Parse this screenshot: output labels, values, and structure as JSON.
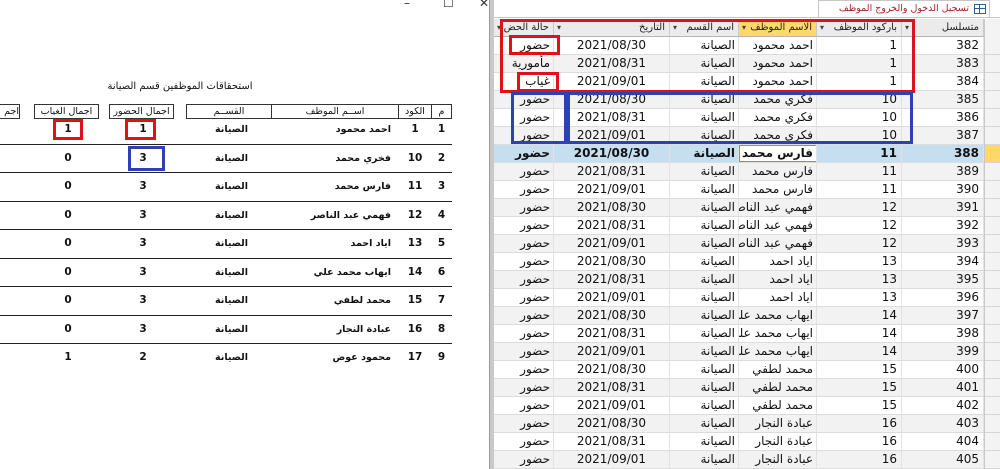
{
  "report": {
    "title": "استحقاقات الموظفين قسم الصيانة",
    "window_buttons": {
      "minimize": "–",
      "maximize": "☐",
      "close": "✕"
    },
    "headers": {
      "seq": "م",
      "code": "الكود",
      "employee": "اســم الموظف",
      "dept": "القســم",
      "total_present": "اجمال الحضور",
      "total_absent": "اجمال الغياب",
      "cut": "اجم"
    },
    "rows": [
      {
        "seq": "1",
        "code": "1",
        "name": "احمد محمود",
        "dept": "الصيانة",
        "present": "1",
        "absent": "1"
      },
      {
        "seq": "2",
        "code": "10",
        "name": "فخري محمد",
        "dept": "الصيانة",
        "present": "3",
        "absent": "0"
      },
      {
        "seq": "3",
        "code": "11",
        "name": "فارس محمد",
        "dept": "الصيانة",
        "present": "3",
        "absent": "0"
      },
      {
        "seq": "4",
        "code": "12",
        "name": "فهمي عبد الناصر",
        "dept": "الصيانة",
        "present": "3",
        "absent": "0"
      },
      {
        "seq": "5",
        "code": "13",
        "name": "اياد احمد",
        "dept": "الصيانة",
        "present": "3",
        "absent": "0"
      },
      {
        "seq": "6",
        "code": "14",
        "name": "ايهاب محمد علي",
        "dept": "الصيانة",
        "present": "3",
        "absent": "0"
      },
      {
        "seq": "7",
        "code": "15",
        "name": "محمد لطفي",
        "dept": "الصيانة",
        "present": "3",
        "absent": "0"
      },
      {
        "seq": "8",
        "code": "16",
        "name": "عبادة النجار",
        "dept": "الصيانة",
        "present": "3",
        "absent": "0"
      },
      {
        "seq": "9",
        "code": "17",
        "name": "محمود عوض",
        "dept": "الصيانة",
        "present": "2",
        "absent": "1"
      }
    ]
  },
  "datasheet": {
    "tab_title": "تسجيل الدخول والخروج الموظف",
    "columns": {
      "serial": "متسلسل",
      "barcode": "باركود الموظف",
      "name": "الاسم الموظف",
      "dept": "اسم القسم",
      "date": "التاريخ",
      "status": "حالة الحض"
    },
    "rows": [
      {
        "serial": "382",
        "barcode": "1",
        "name": "احمد محمود",
        "dept": "الصيانة",
        "date": "2021/08/30",
        "status": "حضور"
      },
      {
        "serial": "383",
        "barcode": "1",
        "name": "احمد محمود",
        "dept": "الصيانة",
        "date": "2021/08/31",
        "status": "مأمورية"
      },
      {
        "serial": "384",
        "barcode": "1",
        "name": "احمد محمود",
        "dept": "الصيانة",
        "date": "2021/09/01",
        "status": "غياب"
      },
      {
        "serial": "385",
        "barcode": "10",
        "name": "فكري محمد",
        "dept": "الصيانة",
        "date": "2021/08/30",
        "status": "حضور"
      },
      {
        "serial": "386",
        "barcode": "10",
        "name": "فكري محمد",
        "dept": "الصيانة",
        "date": "2021/08/31",
        "status": "حضور"
      },
      {
        "serial": "387",
        "barcode": "10",
        "name": "فكري محمد",
        "dept": "الصيانة",
        "date": "2021/09/01",
        "status": "حضور"
      },
      {
        "serial": "388",
        "barcode": "11",
        "name": "فارس محمد",
        "dept": "الصيانة",
        "date": "2021/08/30",
        "status": "حضور"
      },
      {
        "serial": "389",
        "barcode": "11",
        "name": "فارس محمد",
        "dept": "الصيانة",
        "date": "2021/08/31",
        "status": "حضور"
      },
      {
        "serial": "390",
        "barcode": "11",
        "name": "فارس محمد",
        "dept": "الصيانة",
        "date": "2021/09/01",
        "status": "حضور"
      },
      {
        "serial": "391",
        "barcode": "12",
        "name": "فهمي عبد الناصر",
        "dept": "الصيانة",
        "date": "2021/08/30",
        "status": "حضور"
      },
      {
        "serial": "392",
        "barcode": "12",
        "name": "فهمي عبد الناصر",
        "dept": "الصيانة",
        "date": "2021/08/31",
        "status": "حضور"
      },
      {
        "serial": "393",
        "barcode": "12",
        "name": "فهمي عبد الناصر",
        "dept": "الصيانة",
        "date": "2021/09/01",
        "status": "حضور"
      },
      {
        "serial": "394",
        "barcode": "13",
        "name": "اياد احمد",
        "dept": "الصيانة",
        "date": "2021/08/30",
        "status": "حضور"
      },
      {
        "serial": "395",
        "barcode": "13",
        "name": "اياد احمد",
        "dept": "الصيانة",
        "date": "2021/08/31",
        "status": "حضور"
      },
      {
        "serial": "396",
        "barcode": "13",
        "name": "اياد احمد",
        "dept": "الصيانة",
        "date": "2021/09/01",
        "status": "حضور"
      },
      {
        "serial": "397",
        "barcode": "14",
        "name": "ايهاب محمد علي",
        "dept": "الصيانة",
        "date": "2021/08/30",
        "status": "حضور"
      },
      {
        "serial": "398",
        "barcode": "14",
        "name": "ايهاب محمد علي",
        "dept": "الصيانة",
        "date": "2021/08/31",
        "status": "حضور"
      },
      {
        "serial": "399",
        "barcode": "14",
        "name": "ايهاب محمد علي",
        "dept": "الصيانة",
        "date": "2021/09/01",
        "status": "حضور"
      },
      {
        "serial": "400",
        "barcode": "15",
        "name": "محمد لطفي",
        "dept": "الصيانة",
        "date": "2021/08/30",
        "status": "حضور"
      },
      {
        "serial": "401",
        "barcode": "15",
        "name": "محمد لطفي",
        "dept": "الصيانة",
        "date": "2021/08/31",
        "status": "حضور"
      },
      {
        "serial": "402",
        "barcode": "15",
        "name": "محمد لطفي",
        "dept": "الصيانة",
        "date": "2021/09/01",
        "status": "حضور"
      },
      {
        "serial": "403",
        "barcode": "16",
        "name": "عبادة النجار",
        "dept": "الصيانة",
        "date": "2021/08/30",
        "status": "حضور"
      },
      {
        "serial": "404",
        "barcode": "16",
        "name": "عبادة النجار",
        "dept": "الصيانة",
        "date": "2021/08/31",
        "status": "حضور"
      },
      {
        "serial": "405",
        "barcode": "16",
        "name": "عبادة النجار",
        "dept": "الصيانة",
        "date": "2021/09/01",
        "status": "حضور"
      }
    ],
    "current_row_index": 6
  },
  "colors": {
    "annotation_red": "#e0111b",
    "annotation_blue": "#2f3fb4",
    "selected_header": "#ffd86a",
    "current_row": "#c5dff1",
    "tab_text": "#a4262c"
  }
}
